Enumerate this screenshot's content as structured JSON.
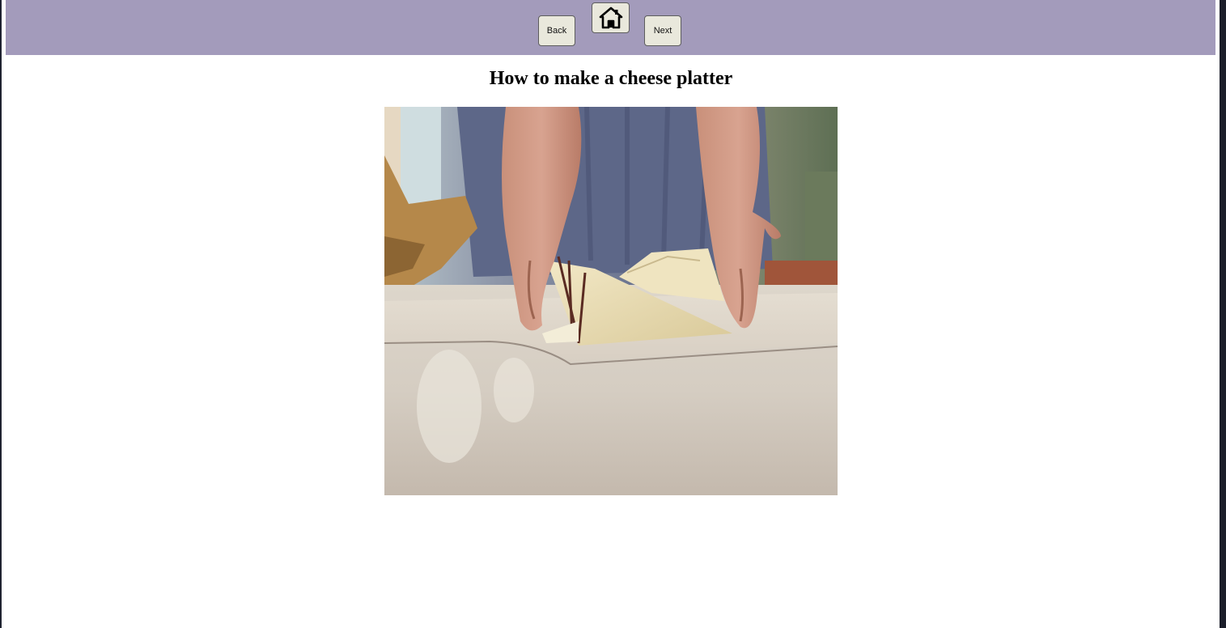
{
  "nav": {
    "back_label": "Back",
    "next_label": "Next",
    "home_icon": "home-icon"
  },
  "page": {
    "title": "How to make a cheese platter"
  },
  "image": {
    "subject": "photo",
    "icon": "photo-image"
  },
  "colors": {
    "navbar": "#a39bbb",
    "button_bg": "#e9e8dc",
    "page_bg": "#ffffff",
    "frame_edge": "#1b1e2a"
  }
}
